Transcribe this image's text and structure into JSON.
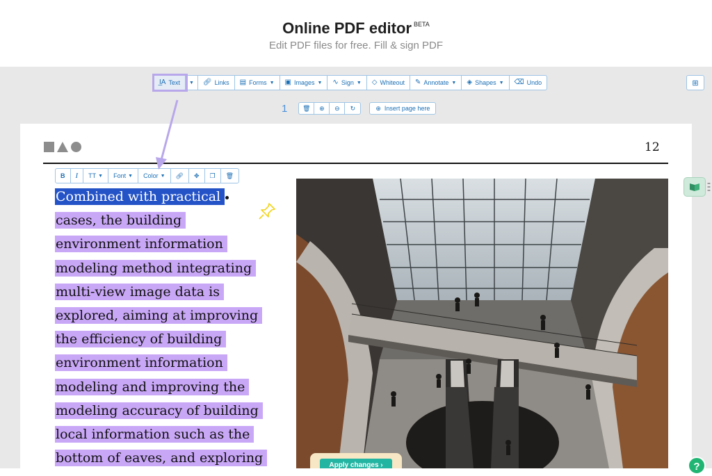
{
  "header": {
    "title": "Online PDF editor",
    "beta": "BETA",
    "subtitle": "Edit PDF files for free. Fill & sign PDF"
  },
  "toolbar": {
    "text": "Text",
    "links": "Links",
    "forms": "Forms",
    "images": "Images",
    "sign": "Sign",
    "whiteout": "Whiteout",
    "annotate": "Annotate",
    "shapes": "Shapes",
    "undo": "Undo"
  },
  "page_controls": {
    "page_number": "1",
    "insert_page": "Insert page here"
  },
  "document": {
    "page_number": "12",
    "lines": [
      "Combined with practical",
      "cases, the building",
      "environment information",
      "modeling method integrating",
      "multi-view image data is",
      "explored, aiming at improving",
      "the efficiency of building",
      "environment information",
      "modeling and improving the",
      "modeling accuracy of building",
      "local information such as the",
      "bottom of eaves, and exploring"
    ]
  },
  "format_toolbar": {
    "bold": "B",
    "italic": "I",
    "size": "TT",
    "font": "Font",
    "color": "Color"
  },
  "apply_button": "Apply changes ›",
  "help": "?",
  "colors": {
    "accent": "#1b6fb5",
    "highlight": "#c9a7f7",
    "selection": "#2453c7",
    "apply": "#24b5a2"
  },
  "icons": [
    "text-cursor-icon",
    "link-icon",
    "forms-icon",
    "image-icon",
    "signature-icon",
    "eraser-icon",
    "pencil-icon",
    "shapes-icon",
    "undo-icon",
    "grid-icon",
    "trash-icon",
    "zoom-in-icon",
    "zoom-out-icon",
    "rotate-icon",
    "plus-circle-icon",
    "move-icon",
    "copy-icon",
    "pin-icon",
    "book-icon",
    "help-icon"
  ]
}
